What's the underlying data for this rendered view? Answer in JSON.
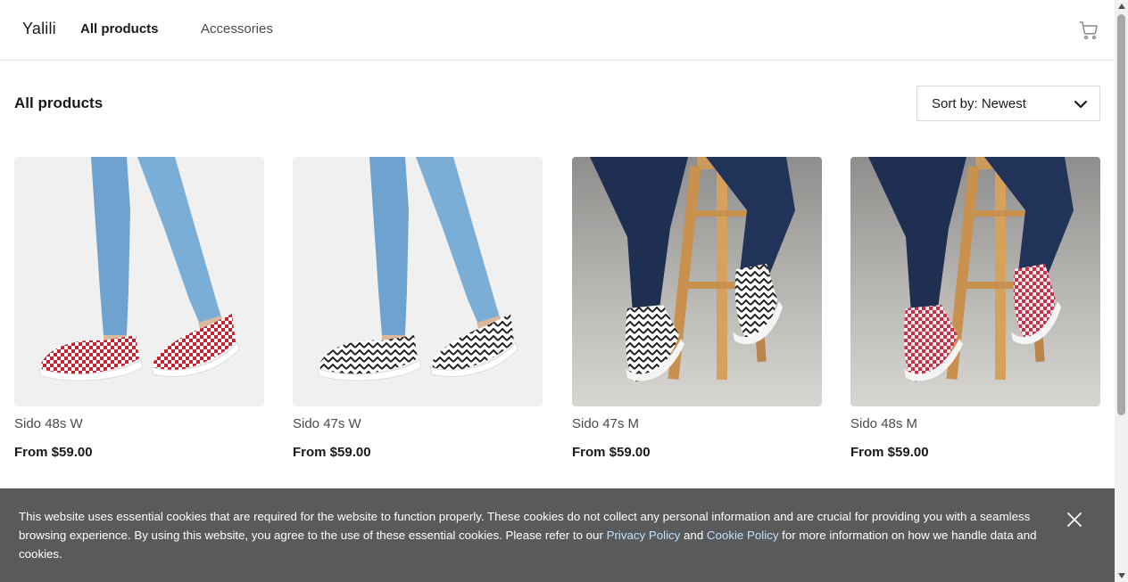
{
  "header": {
    "logo": "Yalili",
    "nav": [
      "All products",
      "Accessories"
    ],
    "cart_icon": "cart-icon"
  },
  "main": {
    "title": "All products",
    "sort_label": "Sort by: Newest"
  },
  "products": [
    {
      "name": "Sido 48s W",
      "price": "From $59.00",
      "image": "jeans-legs-red-checker-slip-ons"
    },
    {
      "name": "Sido 47s W",
      "price": "From $59.00",
      "image": "jeans-legs-black-zigzag-slip-ons"
    },
    {
      "name": "Sido 47s M",
      "price": "From $59.00",
      "image": "stool-black-zigzag-slip-ons"
    },
    {
      "name": "Sido 48s M",
      "price": "From $59.00",
      "image": "stool-red-checker-slip-ons"
    }
  ],
  "cookie_banner": {
    "text_1": "This website uses essential cookies that are required for the website to function properly. These cookies do not collect any personal information and are crucial for providing you with a seamless browsing experience. By using this website, you agree to the use of these essential cookies. Please refer to our ",
    "privacy_link": "Privacy Policy",
    "text_2": " and ",
    "cookie_link": "Cookie Policy",
    "text_3": " for more information on how we handle data and cookies.",
    "close_icon": "close-icon"
  },
  "colors": {
    "banner_bg": "#5a5a5a",
    "link": "#bfe0ff",
    "text": "#1a1a1a"
  }
}
